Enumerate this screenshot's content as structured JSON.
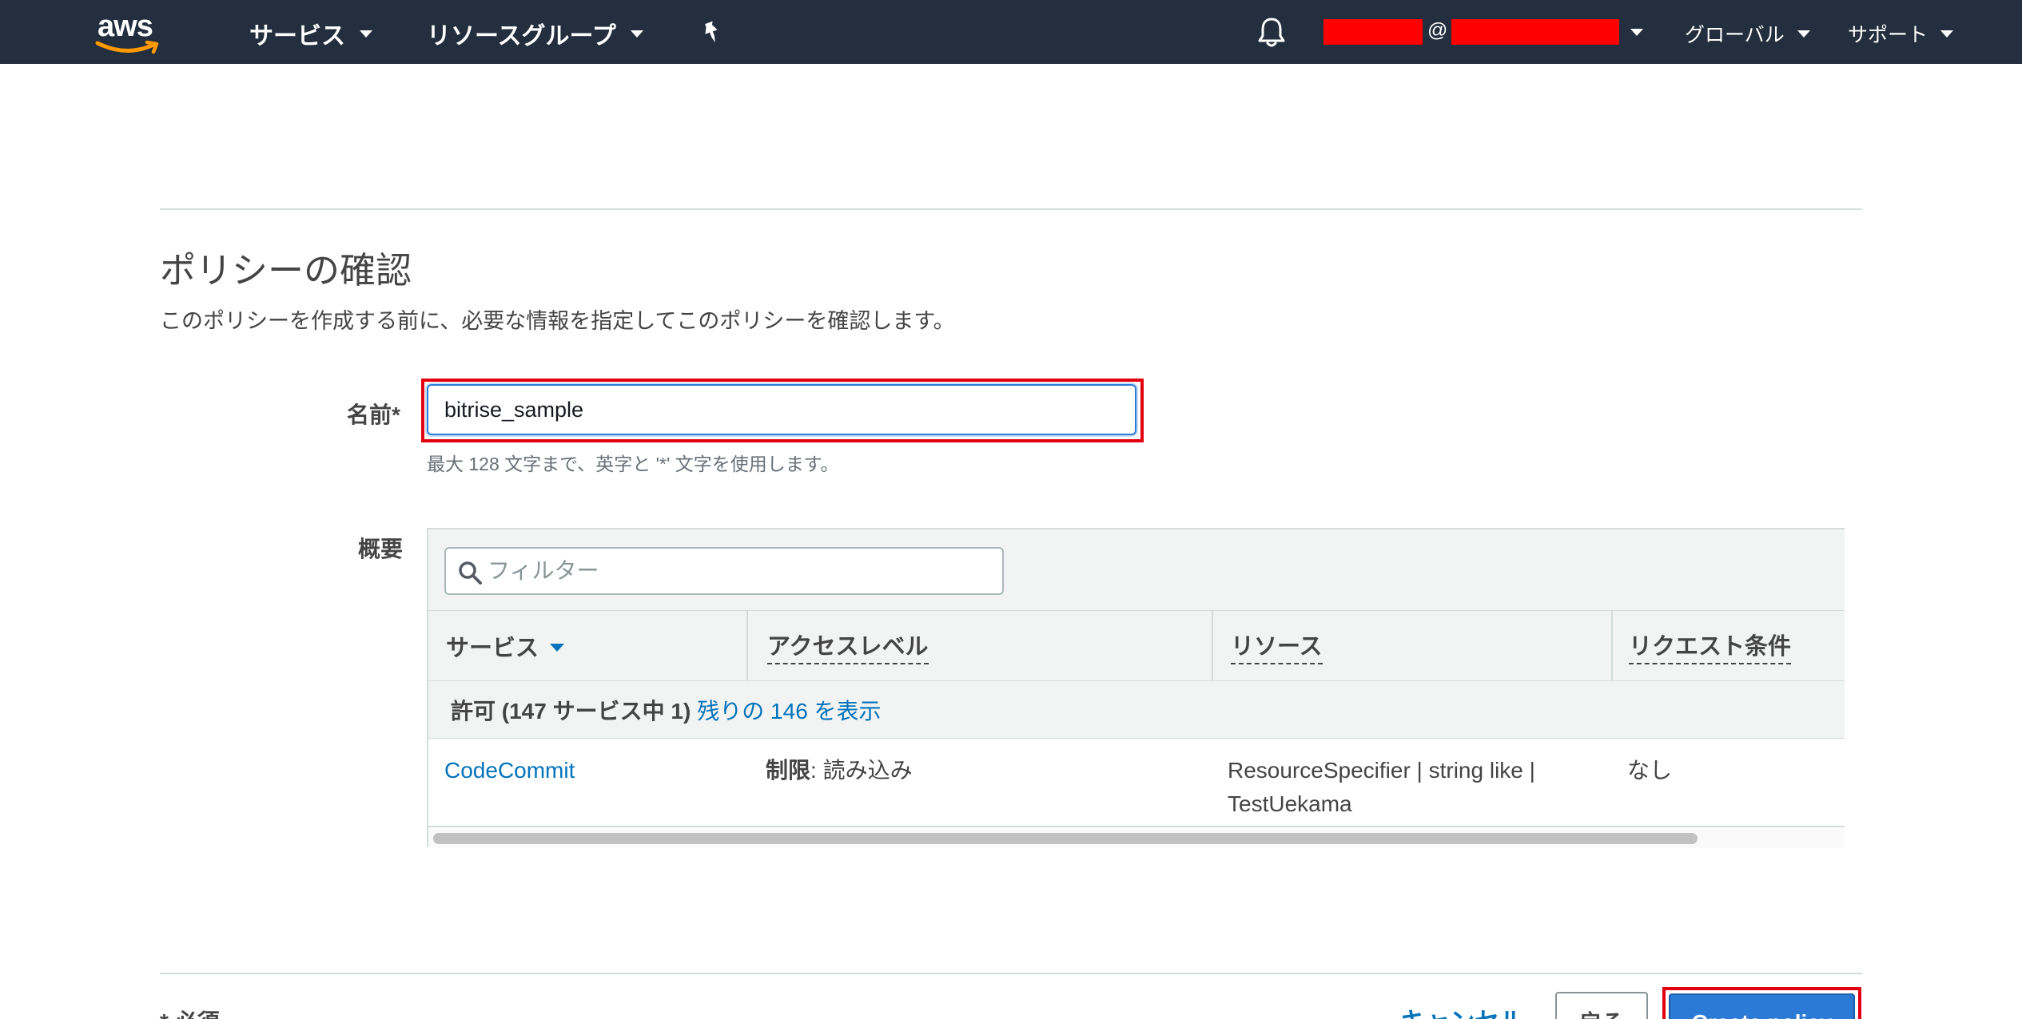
{
  "nav": {
    "logo_text": "aws",
    "services": "サービス",
    "resource_groups": "リソースグループ",
    "at_sign": "@",
    "region": "グローバル",
    "support": "サポート",
    "icons": [
      "pin-icon",
      "bell-icon",
      "chevron-down-icon"
    ]
  },
  "page": {
    "title": "ポリシーの確認",
    "description": "このポリシーを作成する前に、必要な情報を指定してこのポリシーを確認します。"
  },
  "name_field": {
    "label": "名前*",
    "value": "bitrise_sample",
    "hint": "最大 128 文字まで、英字と '*' 文字を使用します。"
  },
  "summary": {
    "label": "概要",
    "filter_placeholder": "フィルター",
    "columns": [
      "サービス",
      "アクセスレベル",
      "リソース",
      "リクエスト条件"
    ],
    "group": {
      "label": "許可 (147 サービス中 1)",
      "link": "残りの 146 を表示"
    },
    "rows": [
      {
        "service": "CodeCommit",
        "access_label": "制限",
        "access_value": ": 読み込み",
        "resource_line1": "ResourceSpecifier | string like |",
        "resource_line2": "TestUekama",
        "condition": "なし"
      }
    ]
  },
  "footer": {
    "required_note": "* 必須",
    "cancel": "キャンセル",
    "back": "戻る",
    "create": "Create policy"
  },
  "colors": {
    "nav_bg": "#232f3e",
    "link": "#0073bb",
    "primary": "#2b7bd6",
    "highlight": "#e2000f",
    "redaction": "#ff0000"
  }
}
